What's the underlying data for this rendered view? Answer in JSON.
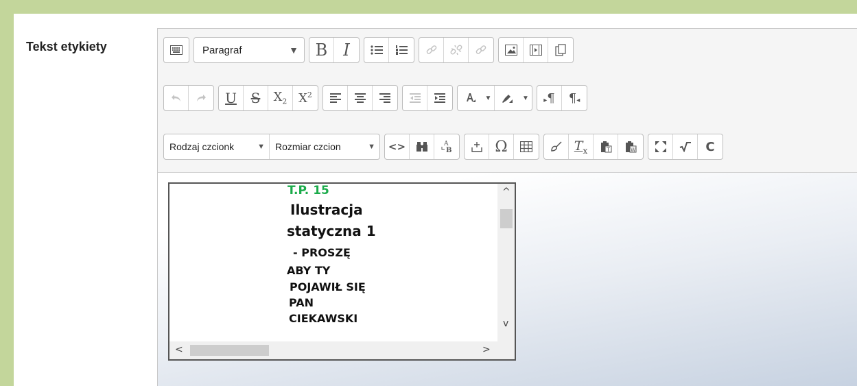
{
  "field_label": "Tekst etykiety",
  "toolbar": {
    "format_select": "Paragraf",
    "font_family_select": "Rodzaj czcionk",
    "font_size_select": "Rozmiar czcion",
    "bold": "B",
    "italic": "I",
    "underline": "U",
    "strike": "S",
    "subscript_base": "X",
    "subscript_mark": "2",
    "superscript_base": "X",
    "superscript_mark": "2",
    "source": "<>",
    "omega": "Ω",
    "clear_format": "T",
    "clear_format_mark": "x",
    "paragraph_ltr": "¶",
    "paragraph_rtl": "¶",
    "redo_c": "C"
  },
  "embedded_content": {
    "lines": [
      "T.P.  15",
      "Ilustracja",
      "statyczna 1",
      "-  PROSZĘ",
      "ABY  TY",
      "POJAWIŁ SIĘ",
      "PAN",
      "CIEKAWSKI"
    ],
    "title_color": "#1aab4a",
    "scroll_up": "^",
    "scroll_down": "v",
    "scroll_left": "<",
    "scroll_right": ">"
  },
  "colors": {
    "page_background": "#c3d69b",
    "panel_background": "#ffffff",
    "toolbar_background": "#f5f5f5"
  }
}
